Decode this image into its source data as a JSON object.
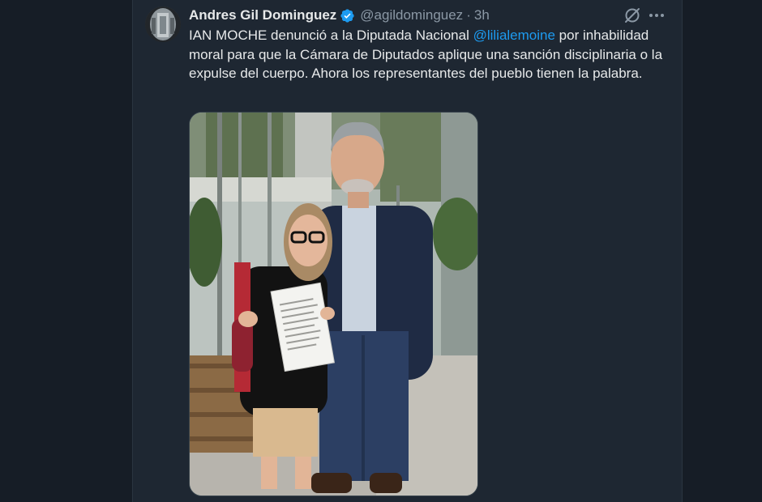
{
  "tweet": {
    "author_name": "Andres Gil Dominguez",
    "handle": "@agildominguez",
    "separator": "·",
    "time": "3h",
    "text_part1": "IAN MOCHE denunció a la Diputada Nacional ",
    "mention": "@lilialemoine",
    "text_part2": " por inhabilidad moral para que la Cámara de Diputados aplique una sanción disciplinaria o la expulse del cuerpo. Ahora los representantes del pueblo tienen la palabra."
  },
  "icons": {
    "verified": "verified-badge-icon",
    "grok": "grok-icon",
    "more": "more-options-icon"
  },
  "colors": {
    "background": "#161d26",
    "panel": "#1e2732",
    "text": "#e7e9ea",
    "secondary_text": "#8b98a5",
    "link": "#1d9bf0"
  }
}
